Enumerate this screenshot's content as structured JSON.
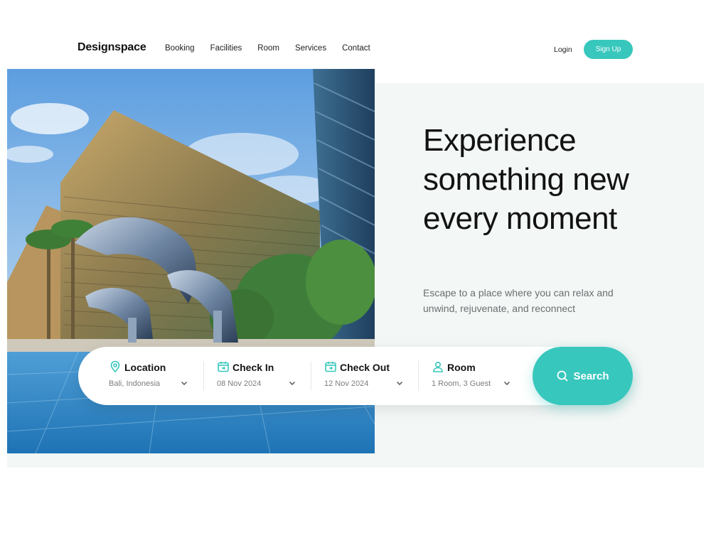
{
  "brand": {
    "name": "Designspace",
    "accent": "#38c7bd"
  },
  "nav": {
    "items": [
      {
        "label": "Booking"
      },
      {
        "label": "Facilities"
      },
      {
        "label": "Room"
      },
      {
        "label": "Services"
      },
      {
        "label": "Contact"
      }
    ],
    "login_label": "Login",
    "signup_label": "Sign Up"
  },
  "hero": {
    "headline": "Experience something new every moment",
    "subtext": "Escape to a place where you can relax and unwind, rejuvenate, and reconnect"
  },
  "search": {
    "fields": [
      {
        "title": "Location",
        "value": "Bali, Indonesia",
        "icon": "map-pin-icon"
      },
      {
        "title": "Check In",
        "value": "08 Nov 2024",
        "icon": "calendar-in-icon"
      },
      {
        "title": "Check Out",
        "value": "12 Nov 2024",
        "icon": "calendar-out-icon"
      },
      {
        "title": "Room",
        "value": "1 Room, 3 Guest",
        "icon": "user-icon"
      }
    ],
    "button_label": "Search",
    "button_icon": "search-icon"
  }
}
